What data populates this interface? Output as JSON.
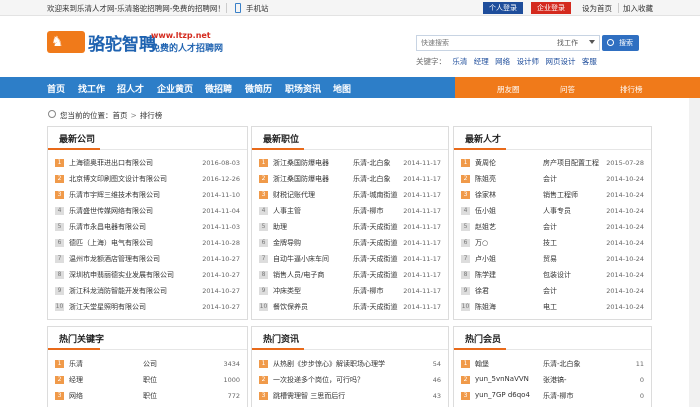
{
  "topbar": {
    "welcome": "欢迎来到乐清人才网-乐清骆驼招聘网-免费的招聘网！",
    "mobile": "手机站",
    "person_login": "个人登录",
    "company_login": "企业登录",
    "set_home": "设为首页",
    "add_fav": "加入收藏"
  },
  "header": {
    "logo_title": "骆驼智聘",
    "logo_url": "www.ltzp.net",
    "logo_slogan": "免费的人才招聘网",
    "search_placeholder": "快速搜索",
    "search_type": "找工作",
    "search_button": "搜索",
    "keywords_label": "关键字：",
    "keywords": [
      "乐清",
      "经理",
      "网络",
      "设计师",
      "网页设计",
      "客服"
    ]
  },
  "nav": {
    "items": [
      "首页",
      "找工作",
      "招人才",
      "企业黄页",
      "微招聘",
      "微简历",
      "职场资讯",
      "地图"
    ],
    "right": [
      "朋友圈",
      "问答",
      "排行榜"
    ]
  },
  "breadcrumb": {
    "label": "您当前的位置：",
    "home": "首页",
    "current": "排行榜"
  },
  "panels": {
    "companies": {
      "title": "最新公司",
      "rows": [
        [
          "上海德奥菲进出口有限公司",
          "2016-08-03"
        ],
        [
          "北京博文印刷图文设计有限公司",
          "2016-12-26"
        ],
        [
          "乐清市宇辉三维技术有限公司",
          "2014-11-10"
        ],
        [
          "乐清盛世传媒网络有限公司",
          "2014-11-04"
        ],
        [
          "乐清市永昌电器有限公司",
          "2014-11-03"
        ],
        [
          "德匹（上海）电气有限公司",
          "2014-10-28"
        ],
        [
          "温州市龙额酒店管理有限公司",
          "2014-10-27"
        ],
        [
          "深圳杭申翡丽德实业发展有限公司",
          "2014-10-27"
        ],
        [
          "浙江科龙消防智能开发有限公司",
          "2014-10-27"
        ],
        [
          "浙江天堂星照明有限公司",
          "2014-10-27"
        ]
      ]
    },
    "jobs": {
      "title": "最新职位",
      "rows": [
        [
          "浙江桑国防爆电器",
          "乐清-北白象",
          "2014-11-17"
        ],
        [
          "浙江桑国防爆电器",
          "乐清-北白象",
          "2014-11-17"
        ],
        [
          "财税记账代理",
          "乐清-城南街道",
          "2014-11-17"
        ],
        [
          "人事主管",
          "乐清-柳市",
          "2014-11-17"
        ],
        [
          "助理",
          "乐清-天成街道",
          "2014-11-17"
        ],
        [
          "金牌导购",
          "乐清-天成街道",
          "2014-11-17"
        ],
        [
          "自动牛逼小床车间",
          "乐清-天成街道",
          "2014-11-17"
        ],
        [
          "销售人员/电子商",
          "乐清-天成街道",
          "2014-11-17"
        ],
        [
          "冲床类型",
          "乐清-柳市",
          "2014-11-17"
        ],
        [
          "餐饮保养员",
          "乐清-天成街道",
          "2014-11-17"
        ]
      ]
    },
    "talents": {
      "title": "最新人才",
      "rows": [
        [
          "黄周伦",
          "房产项目配置工程",
          "2015-07-28"
        ],
        [
          "陈姐亮",
          "会计",
          "2014-10-24"
        ],
        [
          "徐家林",
          "销售工程师",
          "2014-10-24"
        ],
        [
          "伍小姐",
          "人事专员",
          "2014-10-24"
        ],
        [
          "赵姐艺",
          "会计",
          "2014-10-24"
        ],
        [
          "万○",
          "技工",
          "2014-10-24"
        ],
        [
          "卢小姐",
          "贸易",
          "2014-10-24"
        ],
        [
          "陈学建",
          "包装设计",
          "2014-10-24"
        ],
        [
          "徐君",
          "会计",
          "2014-10-24"
        ],
        [
          "陈姐海",
          "电工",
          "2014-10-24"
        ]
      ]
    },
    "hot_keywords": {
      "title": "热门关键字",
      "rows": [
        [
          "乐清",
          "公司",
          "3434"
        ],
        [
          "经理",
          "职位",
          "1000"
        ],
        [
          "网络",
          "职位",
          "772"
        ]
      ]
    },
    "hot_news": {
      "title": "热门资讯",
      "rows": [
        [
          "从热剧《步步惊心》解读职场心理学",
          "54"
        ],
        [
          "一次投递多个岗位，可行吗？",
          "46"
        ],
        [
          "跳槽需理智 三思而后行",
          "43"
        ]
      ]
    },
    "hot_members": {
      "title": "热门会员",
      "rows": [
        [
          "翰堡",
          "乐清-北白象",
          "11"
        ],
        [
          "yun_5vnNaVVN",
          "张港镐-",
          "0"
        ],
        [
          "yun_7GP d6qo4",
          "乐清-柳市",
          "0"
        ]
      ]
    }
  }
}
